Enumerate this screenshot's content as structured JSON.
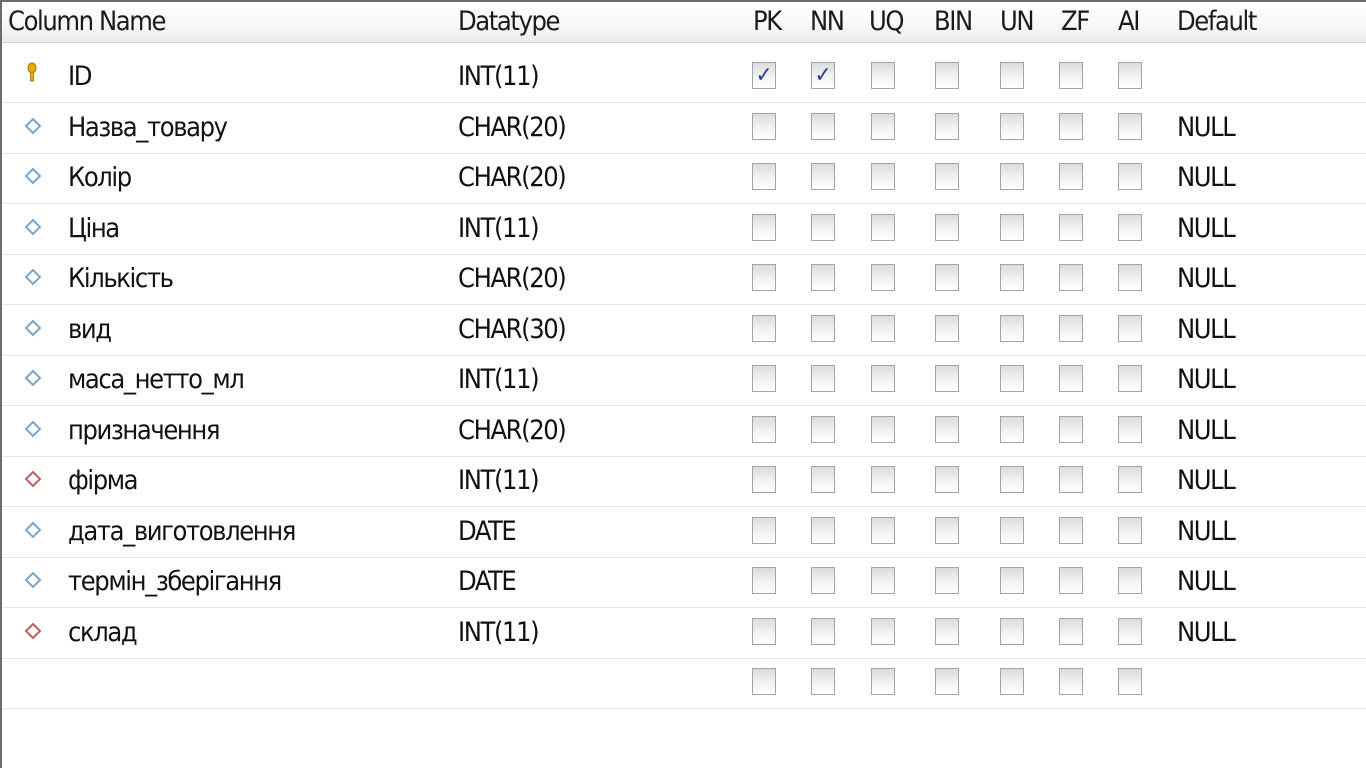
{
  "columns": {
    "name": "Column Name",
    "datatype": "Datatype",
    "flags": [
      "PK",
      "NN",
      "UQ",
      "BIN",
      "UN",
      "ZF",
      "AI"
    ],
    "default": "Default"
  },
  "checkmark_glyph": "✓",
  "rows": [
    {
      "icon": "primary-key-icon",
      "name": "ID",
      "datatype": "INT(11)",
      "flags": [
        true,
        true,
        false,
        false,
        false,
        false,
        false
      ],
      "default": ""
    },
    {
      "icon": "column-diamond-icon",
      "name": "Назва_товару",
      "datatype": "CHAR(20)",
      "flags": [
        false,
        false,
        false,
        false,
        false,
        false,
        false
      ],
      "default": "NULL"
    },
    {
      "icon": "column-diamond-icon",
      "name": "Колір",
      "datatype": "CHAR(20)",
      "flags": [
        false,
        false,
        false,
        false,
        false,
        false,
        false
      ],
      "default": "NULL"
    },
    {
      "icon": "column-diamond-icon",
      "name": "Ціна",
      "datatype": "INT(11)",
      "flags": [
        false,
        false,
        false,
        false,
        false,
        false,
        false
      ],
      "default": "NULL"
    },
    {
      "icon": "column-diamond-icon",
      "name": "Кількість",
      "datatype": "CHAR(20)",
      "flags": [
        false,
        false,
        false,
        false,
        false,
        false,
        false
      ],
      "default": "NULL"
    },
    {
      "icon": "column-diamond-icon",
      "name": "вид",
      "datatype": "CHAR(30)",
      "flags": [
        false,
        false,
        false,
        false,
        false,
        false,
        false
      ],
      "default": "NULL"
    },
    {
      "icon": "column-diamond-icon",
      "name": "маса_нетто_мл",
      "datatype": "INT(11)",
      "flags": [
        false,
        false,
        false,
        false,
        false,
        false,
        false
      ],
      "default": "NULL"
    },
    {
      "icon": "column-diamond-icon",
      "name": "призначення",
      "datatype": "CHAR(20)",
      "flags": [
        false,
        false,
        false,
        false,
        false,
        false,
        false
      ],
      "default": "NULL"
    },
    {
      "icon": "foreign-key-diamond-icon",
      "name": "фірма",
      "datatype": "INT(11)",
      "flags": [
        false,
        false,
        false,
        false,
        false,
        false,
        false
      ],
      "default": "NULL"
    },
    {
      "icon": "column-diamond-icon",
      "name": "дата_виготовлення",
      "datatype": "DATE",
      "flags": [
        false,
        false,
        false,
        false,
        false,
        false,
        false
      ],
      "default": "NULL"
    },
    {
      "icon": "column-diamond-icon",
      "name": "термін_зберігання",
      "datatype": "DATE",
      "flags": [
        false,
        false,
        false,
        false,
        false,
        false,
        false
      ],
      "default": "NULL"
    },
    {
      "icon": "foreign-key-diamond-icon",
      "name": "склад",
      "datatype": "INT(11)",
      "flags": [
        false,
        false,
        false,
        false,
        false,
        false,
        false
      ],
      "default": "NULL"
    },
    {
      "icon": "",
      "name": "",
      "datatype": "",
      "flags": [
        false,
        false,
        false,
        false,
        false,
        false,
        false
      ],
      "default": ""
    }
  ],
  "colors": {
    "key_icon": "#e0b000",
    "column_icon": "#7aa6c8",
    "foreign_key_icon": "#c06060",
    "checkmark": "#2c3f8f"
  }
}
